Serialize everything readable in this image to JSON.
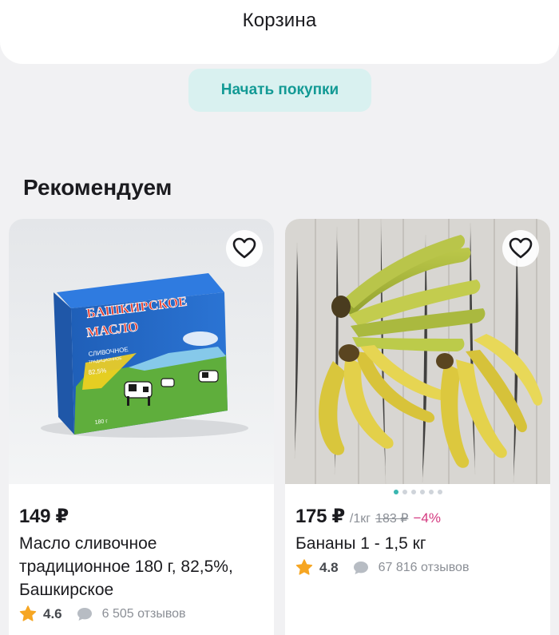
{
  "header": {
    "title": "Корзина"
  },
  "start_button": {
    "label": "Начать покупки"
  },
  "section": {
    "title": "Рекомендуем"
  },
  "products": [
    {
      "price": "149 ₽",
      "name": "Масло сливочное традиционное 180 г, 82,5%, Башкирское",
      "rating": "4.6",
      "reviews": "6 505 отзывов",
      "package_text": [
        "БАШКИРСКОЕ",
        "МАСЛО",
        "СЛИВОЧНОЕ",
        "ТРАДИЦИОННОЕ",
        "82,5%",
        "180 г"
      ],
      "favorite_icon": "heart-outline-icon"
    },
    {
      "price": "175 ₽",
      "unit": "/1кг",
      "old_price": "183 ₽",
      "discount": "−4%",
      "name": "Бананы 1 - 1,5 кг",
      "rating": "4.8",
      "reviews": "67 816 отзывов",
      "favorite_icon": "heart-outline-icon",
      "gallery": {
        "images": 6,
        "active": 1
      }
    }
  ],
  "colors": {
    "accent": "#139a95",
    "accent_bg": "#d9f1f0",
    "discount": "#d4387f",
    "star": "#f6a623",
    "muted": "#8b8f96"
  }
}
